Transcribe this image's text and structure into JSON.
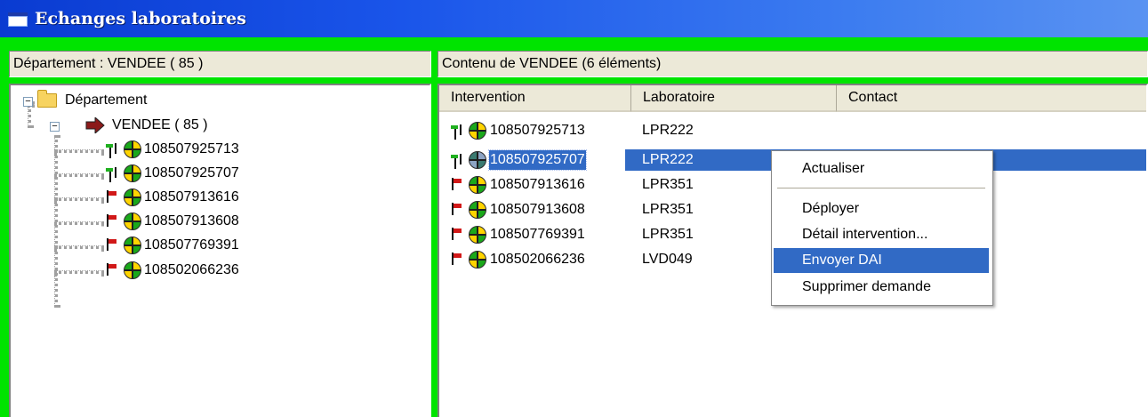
{
  "window": {
    "title": "Echanges laboratoires"
  },
  "left_panel": {
    "header": "Département : VENDEE ( 85 )",
    "tree": {
      "root_label": "Département",
      "department_label": "VENDEE ( 85 )",
      "children": [
        {
          "label": "108507925713",
          "flag": "green-flag-icon"
        },
        {
          "label": "108507925707",
          "flag": "green-flag-icon"
        },
        {
          "label": "108507913616",
          "flag": "red-flag-icon"
        },
        {
          "label": "108507913608",
          "flag": "red-flag-icon"
        },
        {
          "label": "108507769391",
          "flag": "red-flag-icon"
        },
        {
          "label": "108502066236",
          "flag": "red-flag-icon"
        }
      ]
    }
  },
  "right_panel": {
    "header": "Contenu de  VENDEE (6 éléments)",
    "columns": [
      "Intervention",
      "Laboratoire",
      "Contact"
    ],
    "rows": [
      {
        "intervention": "108507925713",
        "laboratoire": "LPR222",
        "flag": "green-flag-icon"
      },
      {
        "intervention": "108507925707",
        "laboratoire": "LPR222",
        "flag": "green-flag-icon",
        "selected": true
      },
      {
        "intervention": "108507913616",
        "laboratoire": "LPR351",
        "flag": "red-flag-icon"
      },
      {
        "intervention": "108507913608",
        "laboratoire": "LPR351",
        "flag": "red-flag-icon"
      },
      {
        "intervention": "108507769391",
        "laboratoire": "LPR351",
        "flag": "red-flag-icon"
      },
      {
        "intervention": "108502066236",
        "laboratoire": "LVD049",
        "flag": "red-flag-icon"
      }
    ]
  },
  "context_menu": {
    "items": [
      {
        "label": "Actualiser"
      },
      {
        "label": "Déployer"
      },
      {
        "label": "Détail intervention..."
      },
      {
        "label": "Envoyer DAI",
        "highlighted": true
      },
      {
        "label": "Supprimer demande"
      }
    ]
  },
  "colors": {
    "window_background": "#00e400",
    "titlebar": "#1a55ea",
    "selection": "#316ac5"
  }
}
